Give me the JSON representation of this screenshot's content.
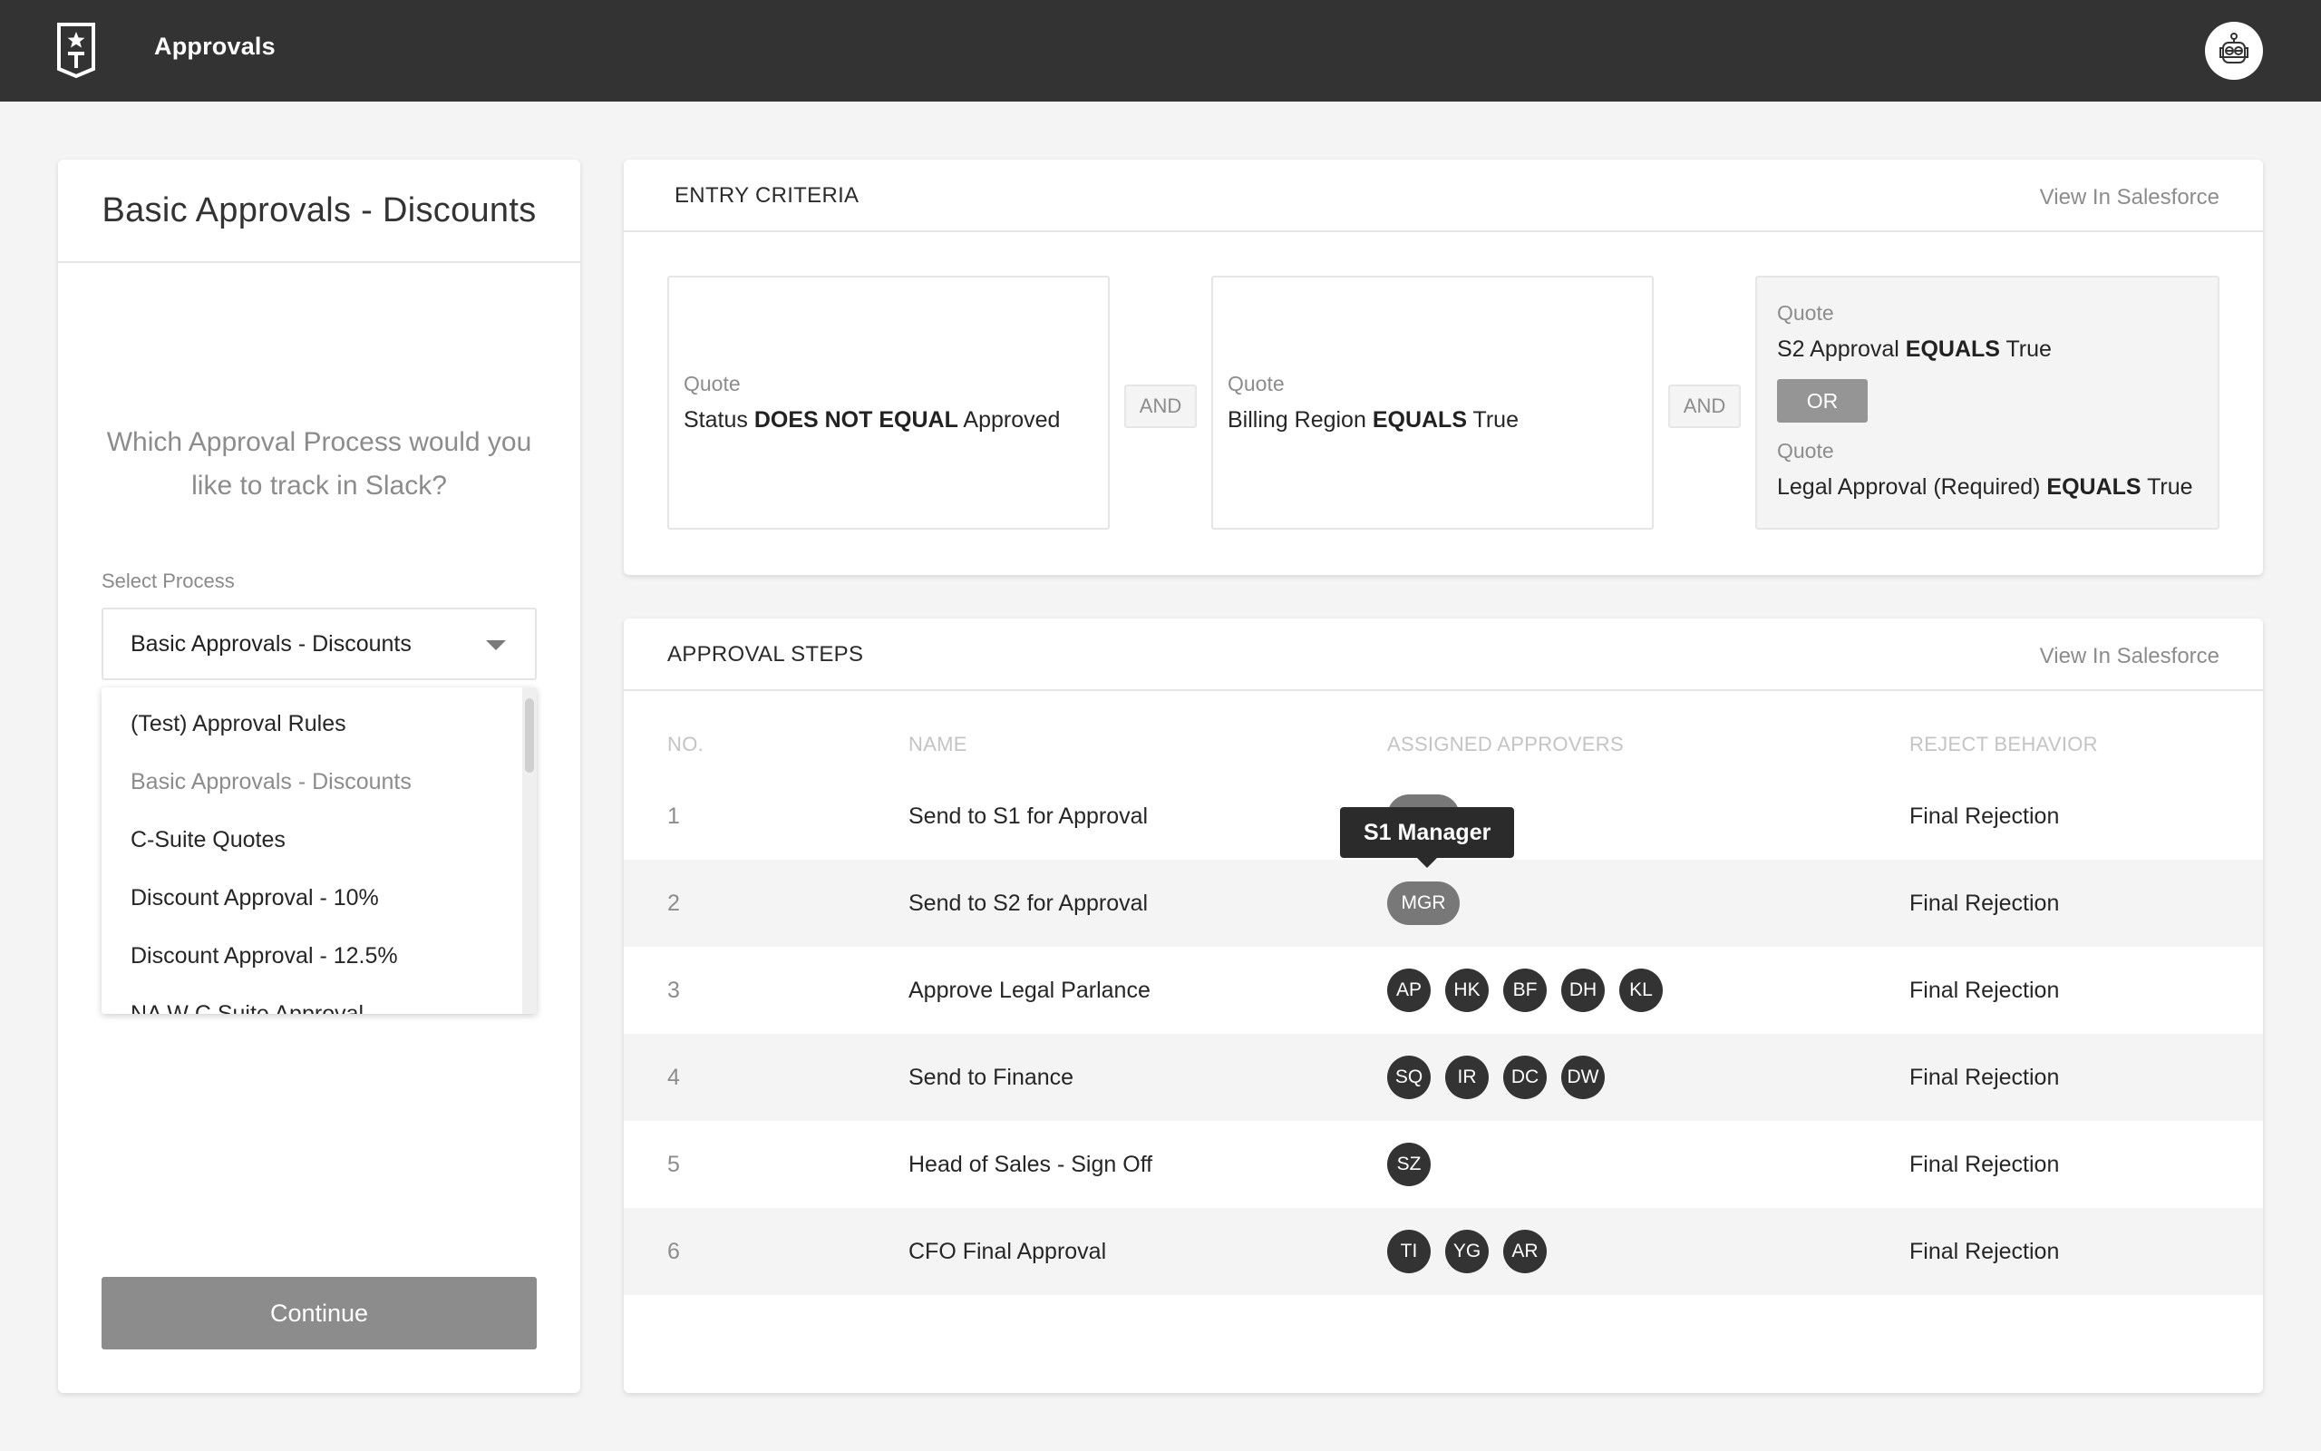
{
  "app": {
    "title": "Approvals",
    "logo_icon": "star-t-shield-icon",
    "bot_icon": "robot-icon"
  },
  "left_panel": {
    "title": "Basic Approvals - Discounts",
    "question": "Which Approval Process would you like to track in Slack?",
    "select_label": "Select Process",
    "select_value": "Basic Approvals - Discounts",
    "options": [
      {
        "label": "(Test) Approval Rules",
        "selected": false
      },
      {
        "label": "Basic Approvals - Discounts",
        "selected": true
      },
      {
        "label": "C-Suite Quotes",
        "selected": false
      },
      {
        "label": "Discount Approval - 10%",
        "selected": false
      },
      {
        "label": "Discount Approval - 12.5%",
        "selected": false
      },
      {
        "label": "NA W C Suite Approval",
        "selected": false
      }
    ],
    "continue_label": "Continue"
  },
  "entry_criteria": {
    "title": "ENTRY CRITERIA",
    "link": "View In Salesforce",
    "connector": "AND",
    "criteria": [
      {
        "object": "Quote",
        "field": "Status",
        "operator": "DOES NOT EQUAL",
        "value": "Approved"
      },
      {
        "object": "Quote",
        "field": "Billing Region",
        "operator": "EQUALS",
        "value": "True"
      }
    ],
    "or_group": {
      "connector": "OR",
      "criteria": [
        {
          "object": "Quote",
          "field": "S2 Approval",
          "operator": "EQUALS",
          "value": "True"
        },
        {
          "object": "Quote",
          "field": "Legal Approval (Required) ",
          "operator": "EQUALS",
          "value": "True"
        }
      ]
    }
  },
  "approval_steps": {
    "title": "APPROVAL STEPS",
    "link": "View In Salesforce",
    "columns": [
      "NO.",
      "NAME",
      "ASSIGNED APPROVERS",
      "REJECT BEHAVIOR"
    ],
    "tooltip": "S1 Manager",
    "rows": [
      {
        "no": "1",
        "name": "Send to S1 for Approval",
        "approvers": [
          "MGR"
        ],
        "approver_type": "role",
        "reject": "Final Rejection"
      },
      {
        "no": "2",
        "name": "Send to S2 for Approval",
        "approvers": [
          "MGR"
        ],
        "approver_type": "role",
        "reject": "Final Rejection"
      },
      {
        "no": "3",
        "name": "Approve Legal Parlance",
        "approvers": [
          "AP",
          "HK",
          "BF",
          "DH",
          "KL"
        ],
        "approver_type": "user",
        "reject": "Final Rejection"
      },
      {
        "no": "4",
        "name": "Send to Finance",
        "approvers": [
          "SQ",
          "IR",
          "DC",
          "DW"
        ],
        "approver_type": "user",
        "reject": "Final Rejection"
      },
      {
        "no": "5",
        "name": "Head of Sales - Sign Off",
        "approvers": [
          "SZ"
        ],
        "approver_type": "user",
        "reject": "Final Rejection"
      },
      {
        "no": "6",
        "name": "CFO Final Approval",
        "approvers": [
          "TI",
          "YG",
          "AR"
        ],
        "approver_type": "user",
        "reject": "Final Rejection"
      }
    ]
  },
  "colors": {
    "topbar": "#333333",
    "background": "#f4f4f4",
    "avatar": "#333333",
    "role_pill": "#787878",
    "button_disabled": "#8c8c8c"
  }
}
